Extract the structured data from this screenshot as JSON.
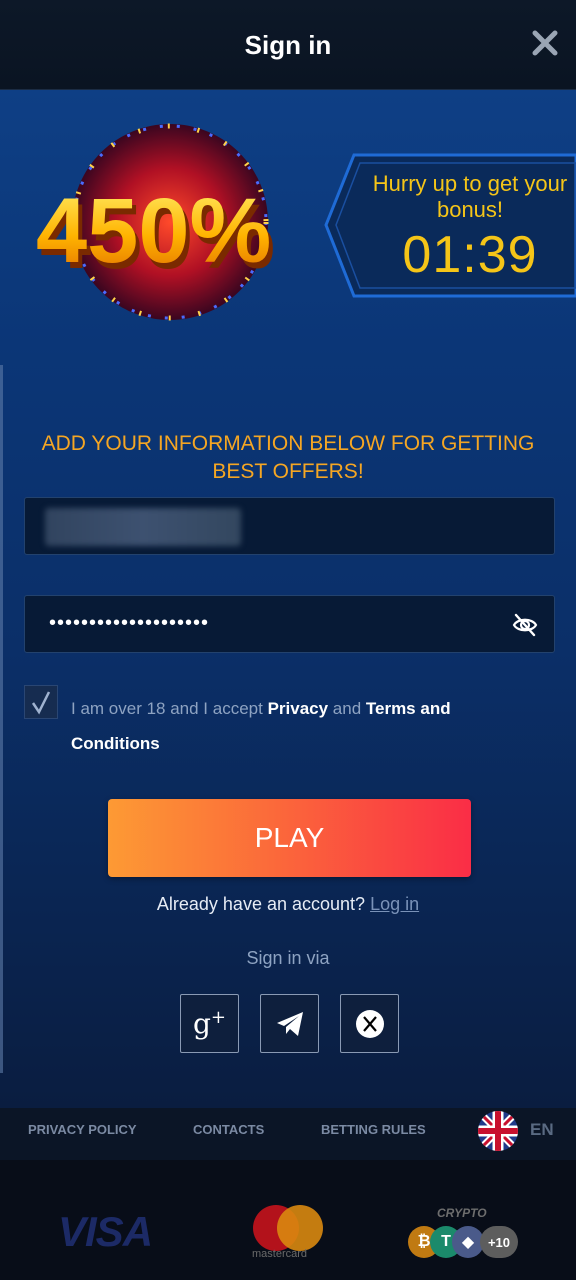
{
  "header": {
    "title": "Sign in",
    "close_icon": "close-icon"
  },
  "promo": {
    "percent": "450%",
    "bonus_text": "Hurry up to get your bonus!",
    "timer": "01:39"
  },
  "form": {
    "headline": "ADD YOUR INFORMATION BELOW FOR GETTING BEST OFFERS!",
    "email_value": "",
    "password_value": "••••••••••••••••••••",
    "consent": {
      "prefix": "I am over 18 and I accept ",
      "privacy": "Privacy",
      "and": " and ",
      "terms": "Terms and Conditions",
      "checked": true
    },
    "play_label": "PLAY",
    "already_text": "Already have an account?",
    "login_link": "Log in",
    "sign_in_via": "Sign in via",
    "socials": [
      "google-plus-icon",
      "telegram-icon",
      "x-icon"
    ]
  },
  "footer": {
    "links": [
      "PRIVACY POLICY",
      "CONTACTS",
      "BETTING RULES"
    ],
    "language": "EN",
    "payments": {
      "visa": "VISA",
      "mastercard": "mastercard",
      "crypto": "CRYPTO",
      "crypto_more": "+10"
    }
  },
  "colors": {
    "accent_yellow": "#f5c518",
    "headline_orange": "#f5a623",
    "play_gradient_start": "#fd9a34",
    "play_gradient_end": "#fa2d46",
    "background_blue": "#0b3677"
  }
}
